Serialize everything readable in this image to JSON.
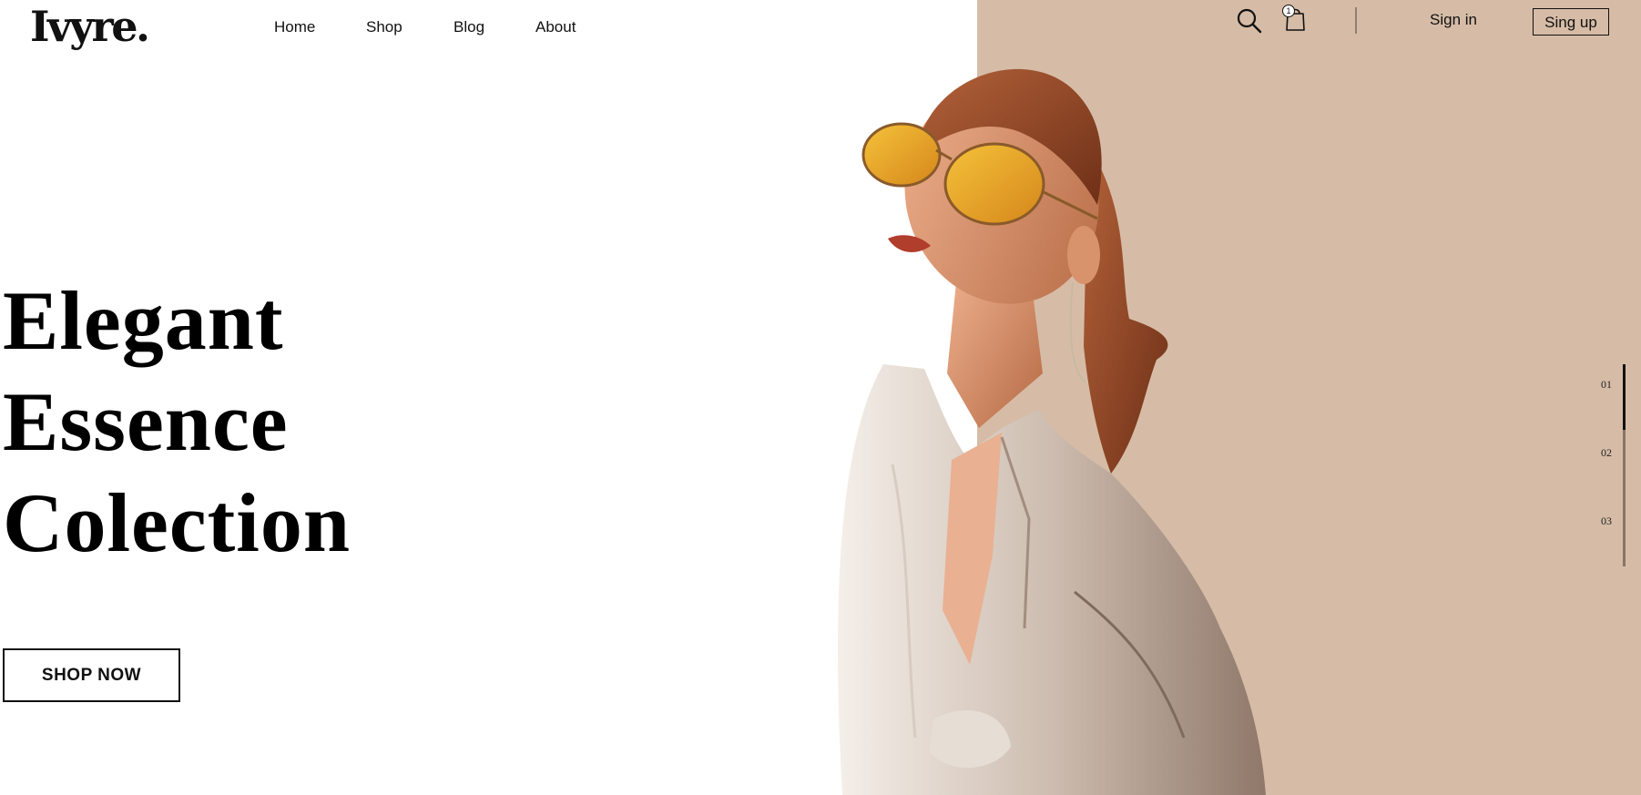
{
  "brand": {
    "name": "Ivyre."
  },
  "nav": {
    "items": [
      "Home",
      "Shop",
      "Blog",
      "About"
    ]
  },
  "header": {
    "search_icon": "search-icon",
    "cart_icon": "shopping-bag-icon",
    "cart_count": "1",
    "signin_label": "Sign in",
    "signup_label": "Sing up"
  },
  "hero": {
    "title_lines": [
      "Elegant",
      "Essence",
      "Colection"
    ],
    "cta_label": "SHOP NOW"
  },
  "slider": {
    "items": [
      "01",
      "02",
      "03"
    ],
    "active": 0
  },
  "colors": {
    "panel": "#d6bca6",
    "accent": "#111111"
  }
}
